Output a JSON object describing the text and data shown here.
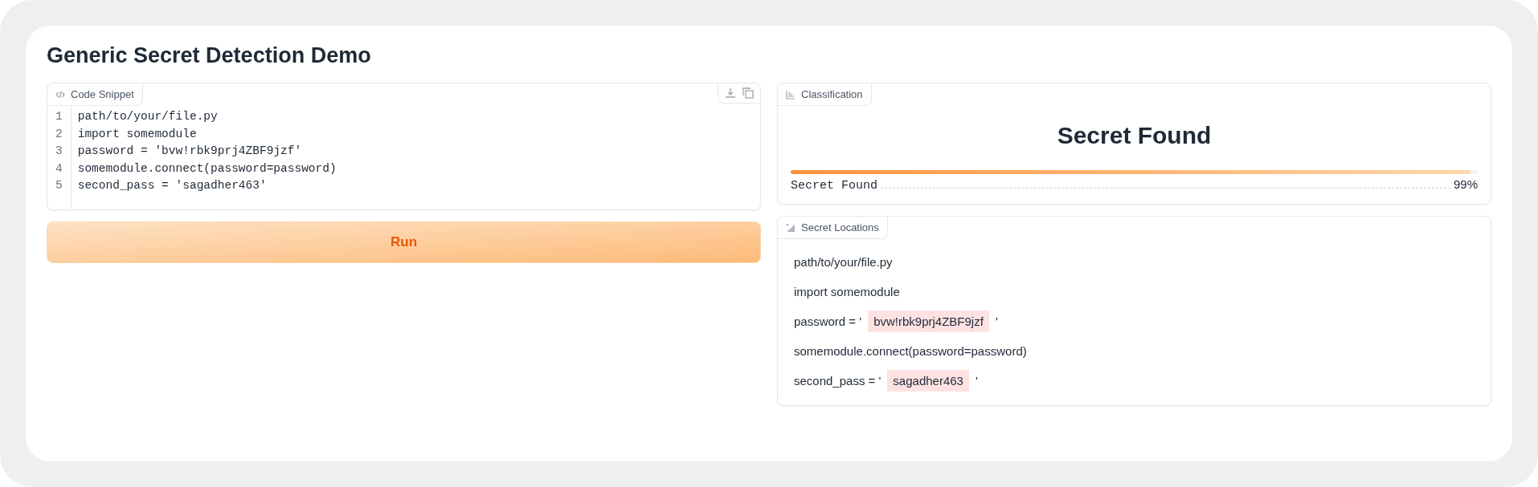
{
  "title": "Generic Secret Detection Demo",
  "code_panel": {
    "label": "Code Snippet",
    "lines": [
      {
        "number": "1",
        "text": "path/to/your/file.py"
      },
      {
        "number": "2",
        "text": "import somemodule"
      },
      {
        "number": "3",
        "text": "password = 'bvw!rbk9prj4ZBF9jzf'"
      },
      {
        "number": "4",
        "text": "somemodule.connect(password=password)"
      },
      {
        "number": "5",
        "text": "second_pass = 'sagadher463'"
      }
    ]
  },
  "run_button": "Run",
  "classification": {
    "label": "Classification",
    "result": "Secret Found",
    "confidences": [
      {
        "label": "Secret Found",
        "level": 0.99,
        "reading": "99%"
      }
    ]
  },
  "locations": {
    "label": "Secret Locations",
    "lines": [
      {
        "segments": [
          {
            "kind": "plain",
            "text": "path/to/your/file.py"
          }
        ]
      },
      {
        "segments": [
          {
            "kind": "plain",
            "text": "import somemodule"
          }
        ]
      },
      {
        "segments": [
          {
            "kind": "plain",
            "text": "password = '"
          },
          {
            "kind": "secret",
            "text": "bvw!rbk9prj4ZBF9jzf"
          },
          {
            "kind": "plain",
            "text": "'"
          }
        ]
      },
      {
        "segments": [
          {
            "kind": "plain",
            "text": "somemodule.connect(password=password)"
          }
        ]
      },
      {
        "segments": [
          {
            "kind": "plain",
            "text": "second_pass = '"
          },
          {
            "kind": "secret",
            "text": "sagadher463"
          },
          {
            "kind": "plain",
            "text": "'"
          }
        ]
      }
    ]
  }
}
